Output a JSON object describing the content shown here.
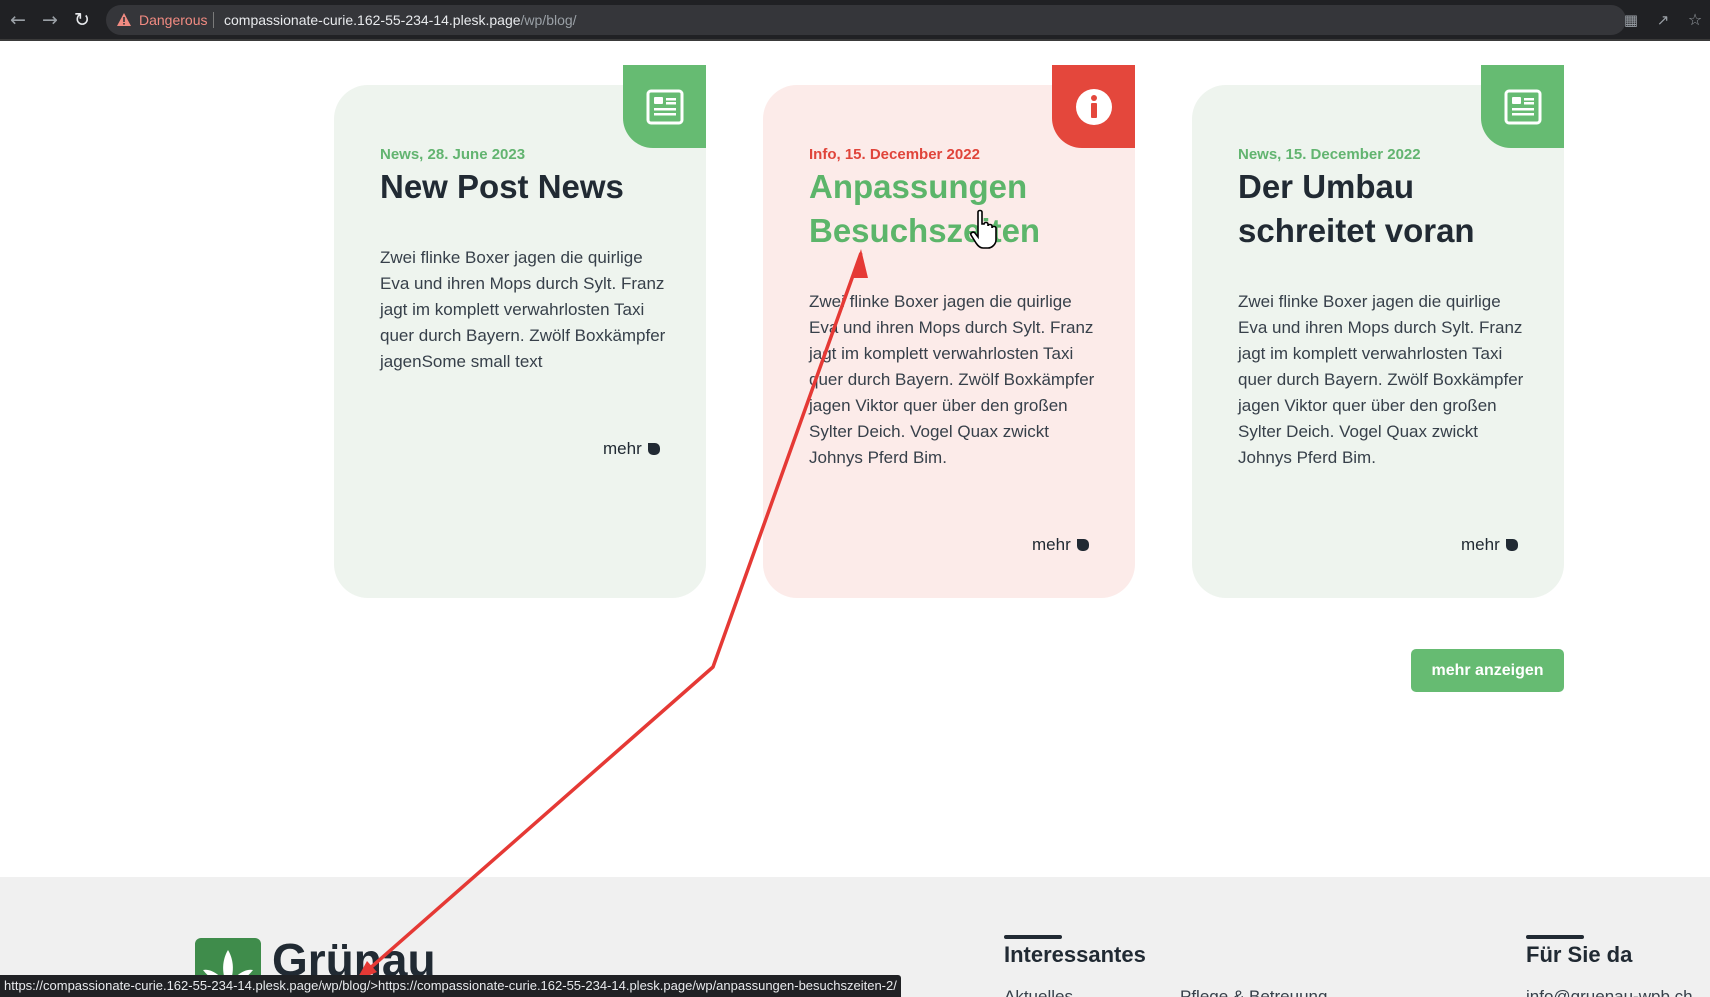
{
  "browser": {
    "security_label": "Dangerous",
    "url_host": "compassionate-curie.162-55-234-14.plesk.page",
    "url_path": "/wp/blog/",
    "back_icon": "arrow-left-icon",
    "forward_icon": "arrow-right-icon",
    "reload_icon": "reload-icon",
    "translate_icon": "translate-icon",
    "share_icon": "share-icon",
    "bookmark_icon": "star-icon"
  },
  "colors": {
    "accent_green": "#66bb72",
    "accent_red": "#e4473c",
    "card_green_bg": "#eef4ee",
    "card_pink_bg": "#fcebe9",
    "text_dark": "#212a33",
    "annotation_arrow": "#e53935"
  },
  "posts": [
    {
      "category": "News",
      "icon": "newspaper-icon",
      "meta": "News, 28. June 2023",
      "title": "New Post News",
      "excerpt": "Zwei flinke Boxer jagen die quirlige Eva und ihren Mops durch Sylt. Franz jagt im komplett verwahrlosten Taxi quer durch Bayern. Zwölf Boxkämpfer jagenSome small text",
      "more_label": "mehr"
    },
    {
      "category": "Info",
      "icon": "info-icon",
      "meta": "Info, 15. December 2022",
      "title": "Anpassungen Besuchszeiten",
      "excerpt": "Zwei flinke Boxer jagen die quirlige Eva und ihren Mops durch Sylt. Franz jagt im komplett verwahrlosten Taxi quer durch Bayern. Zwölf Boxkämpfer jagen Viktor quer über den großen Sylter Deich. Vogel Quax zwickt Johnys Pferd Bim.",
      "more_label": "mehr"
    },
    {
      "category": "News",
      "icon": "newspaper-icon",
      "meta": "News, 15. December 2022",
      "title": "Der Umbau schreitet voran",
      "excerpt": "Zwei flinke Boxer jagen die quirlige Eva und ihren Mops durch Sylt. Franz jagt im komplett verwahrlosten Taxi quer durch Bayern. Zwölf Boxkämpfer jagen Viktor quer über den großen Sylter Deich. Vogel Quax zwickt Johnys Pferd Bim.",
      "more_label": "mehr"
    }
  ],
  "show_more_label": "mehr anzeigen",
  "footer": {
    "logo_text": "Grünau",
    "logo_icon": "leaf-logo-icon",
    "col1_heading": "Interessantes",
    "col1_link1": "Aktuelles",
    "col1_link2": "Pflege & Betreuung",
    "col2_heading": "Für Sie da",
    "col2_contact": "info@gruenau-wpb.ch"
  },
  "status_bar": {
    "text": "https://compassionate-curie.162-55-234-14.plesk.page/wp/blog/>https://compassionate-curie.162-55-234-14.plesk.page/wp/anpassungen-besuchszeiten-2/"
  },
  "cursor_icon": "hand-pointer-icon"
}
